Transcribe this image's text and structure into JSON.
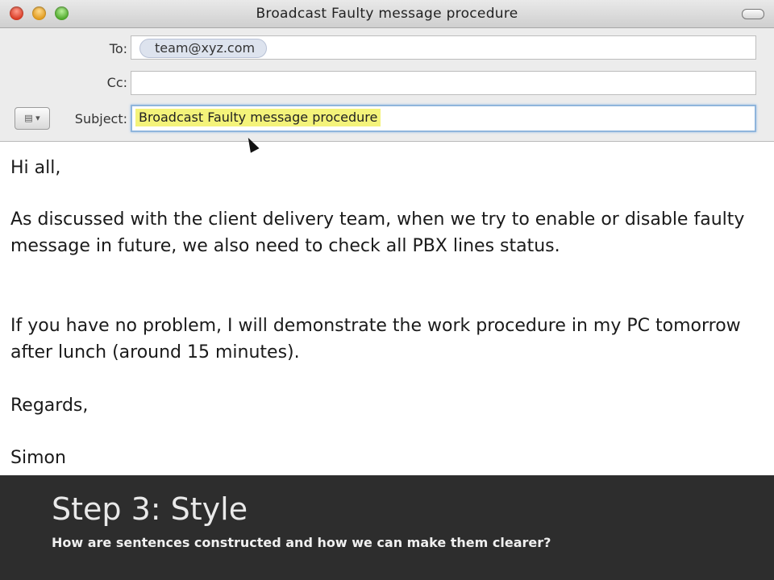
{
  "window": {
    "title": "Broadcast Faulty message procedure"
  },
  "header": {
    "to_label": "To:",
    "to_recipient": "team@xyz.com",
    "cc_label": "Cc:",
    "subject_label": "Subject:",
    "subject_value": "Broadcast Faulty message procedure",
    "account_button": "▤ ▾"
  },
  "body": {
    "greeting": "Hi all,",
    "paragraph1": "As discussed with the client delivery team, when we try to enable or disable faulty message in future, we also need to check all PBX lines status.",
    "paragraph2": "If you have no problem, I will demonstrate the work procedure in my PC tomorrow after lunch (around 15 minutes).",
    "regards": "Regards,",
    "signature": "Simon"
  },
  "overlay": {
    "title": "Step 3: Style",
    "subtitle": "How are sentences constructed and how we can make them clearer?"
  },
  "colors": {
    "highlight": "#f4f37a",
    "overlay_bg": "#2d2d2d",
    "token_bg": "#dde3ee"
  },
  "icons": [
    "close-button-icon",
    "minimize-button-icon",
    "zoom-button-icon",
    "account-selector-icon",
    "mouse-pointer-icon"
  ]
}
